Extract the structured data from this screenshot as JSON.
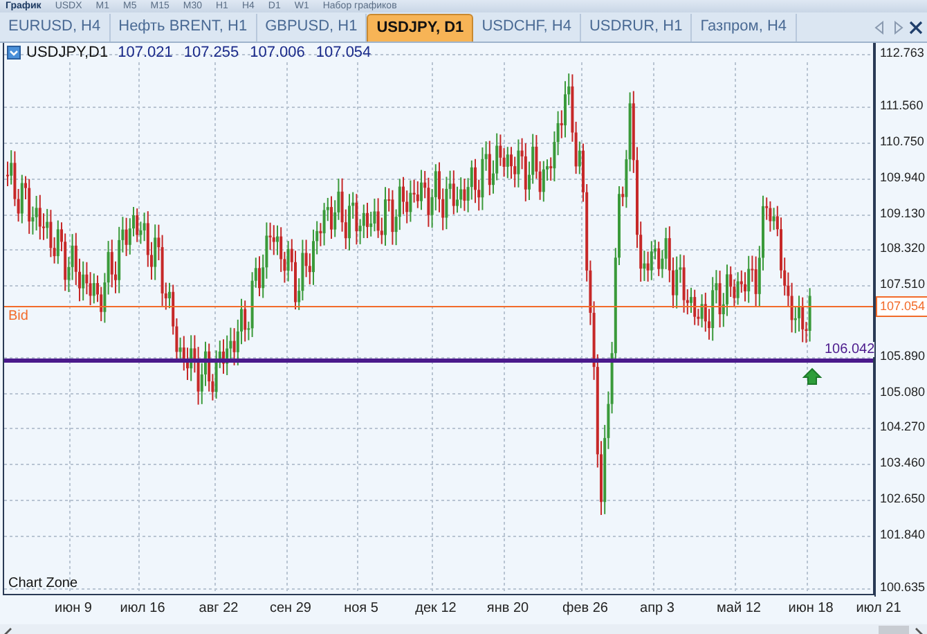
{
  "toolbar": {
    "items": [
      "График",
      "USDX",
      "M1",
      "M5",
      "M15",
      "M30",
      "H1",
      "H4",
      "D1",
      "W1",
      "Набор графиков"
    ]
  },
  "tabs": [
    {
      "label": "EURUSD, H4",
      "selected": false
    },
    {
      "label": "Нефть BRENT, H1",
      "selected": false
    },
    {
      "label": "GBPUSD, H1",
      "selected": false
    },
    {
      "label": "USDJPY, D1",
      "selected": true
    },
    {
      "label": "USDCHF, H4",
      "selected": false
    },
    {
      "label": "USDRUR, H1",
      "selected": false
    },
    {
      "label": "Газпром, H4",
      "selected": false
    }
  ],
  "chart": {
    "symbol": "USDJPY,D1",
    "quotes": [
      "107.021",
      "107.255",
      "107.006",
      "107.054"
    ],
    "price_ticks": [
      "112.763",
      "111.560",
      "110.750",
      "109.940",
      "109.130",
      "108.320",
      "107.510",
      "105.890",
      "105.080",
      "104.270",
      "103.460",
      "102.650",
      "101.840",
      "100.635"
    ],
    "date_labels": [
      "июн 9",
      "июл 16",
      "авг 22",
      "сен 29",
      "ноя 5",
      "дек 12",
      "янв 20",
      "фев 26",
      "апр 3",
      "май 12",
      "июн 18",
      "июл 21"
    ],
    "bid": {
      "label": "Bid",
      "price": "107.054"
    },
    "level_line": {
      "price": "106.042"
    },
    "zone_label": "Chart Zone"
  }
}
